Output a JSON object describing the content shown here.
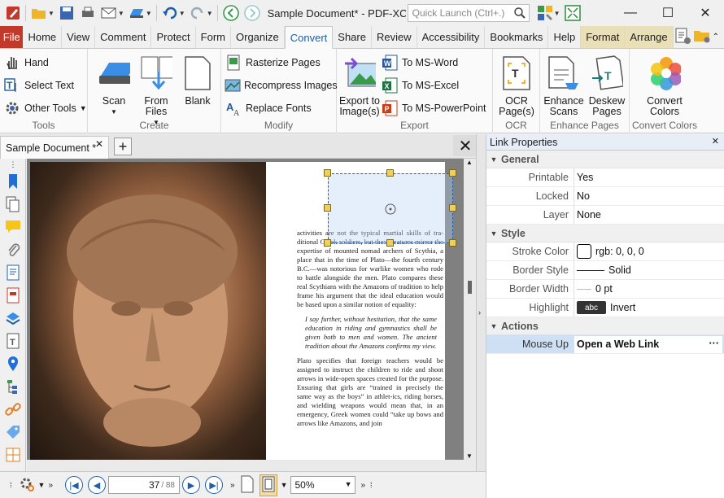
{
  "window": {
    "doc_title": "Sample Document* - PDF-XCh..",
    "quick_launch_placeholder": "Quick Launch (Ctrl+.)"
  },
  "menu": {
    "file": "File",
    "tabs": [
      "Home",
      "View",
      "Comment",
      "Protect",
      "Form",
      "Organize",
      "Convert",
      "Share",
      "Review",
      "Accessibility",
      "Bookmarks",
      "Help",
      "Format",
      "Arrange"
    ]
  },
  "ribbon": {
    "tools": {
      "hand": "Hand",
      "select_text": "Select Text",
      "other_tools": "Other Tools",
      "label": "Tools"
    },
    "create": {
      "scan": "Scan",
      "from_files": "From Files",
      "blank": "Blank",
      "label": "Create"
    },
    "modify": {
      "rasterize": "Rasterize Pages",
      "recompress": "Recompress Images",
      "replace_fonts": "Replace Fonts",
      "label": "Modify"
    },
    "export": {
      "export_image": "Export to Image(s)",
      "to_word": "To MS-Word",
      "to_excel": "To MS-Excel",
      "to_ppt": "To MS-PowerPoint",
      "label": "Export"
    },
    "ocr": {
      "ocr_pages": "OCR Page(s)",
      "label": "OCR"
    },
    "enhance": {
      "enhance_scans": "Enhance Scans",
      "deskew": "Deskew Pages",
      "label": "Enhance Pages"
    },
    "colors": {
      "convert_colors": "Convert Colors",
      "label": "Convert Colors"
    }
  },
  "doctab": {
    "name": "Sample Document *"
  },
  "document": {
    "para1": "activities are not the typical martial skills of tra-ditional Greek soldiers, but these features mirror the expertise of mounted nomad archers of Scythia, a place that in the time of Plato—the fourth century B.C.—was notorious for warlike women who rode to battle alongside the men. Plato compares these real Scythians with the Amazons of tradition to help frame his argument that the ideal education would be based upon a similar notion of equality:",
    "quote": "I say further, without hesitation, that the same education in riding and gymnastics shall be given both to men and women. The ancient tradition about the Amazons confirms my view.",
    "para2": "Plato specifies that foreign teachers would be assigned to instruct the children to ride and shoot arrows in wide-open spaces created for the purpose. Ensuring that girls are “trained in precisely the same way as the boys” in athlet-ics, riding horses, and wielding weapons would mean that, in an emergency, Greek women could “take up bows and arrows like Amazons, and join"
  },
  "navigation": {
    "page_current": "37",
    "page_total": "/ 88",
    "zoom": "50%"
  },
  "panel": {
    "title": "Link Properties",
    "general": {
      "label": "General",
      "printable_k": "Printable",
      "printable_v": "Yes",
      "locked_k": "Locked",
      "locked_v": "No",
      "layer_k": "Layer",
      "layer_v": "None"
    },
    "style": {
      "label": "Style",
      "stroke_k": "Stroke Color",
      "stroke_v": "rgb: 0, 0, 0",
      "border_style_k": "Border Style",
      "border_style_v": "Solid",
      "border_width_k": "Border Width",
      "border_width_v": "0 pt",
      "highlight_k": "Highlight",
      "highlight_swatch": "abc",
      "highlight_v": "Invert"
    },
    "actions": {
      "label": "Actions",
      "mouse_up_k": "Mouse Up",
      "mouse_up_v": "Open a Web Link"
    }
  },
  "colors": {
    "file_tab": "#c0392b",
    "accent": "#1f5fa8",
    "context_tab": "#e9dfb8",
    "selection": "#cfe0f5"
  }
}
